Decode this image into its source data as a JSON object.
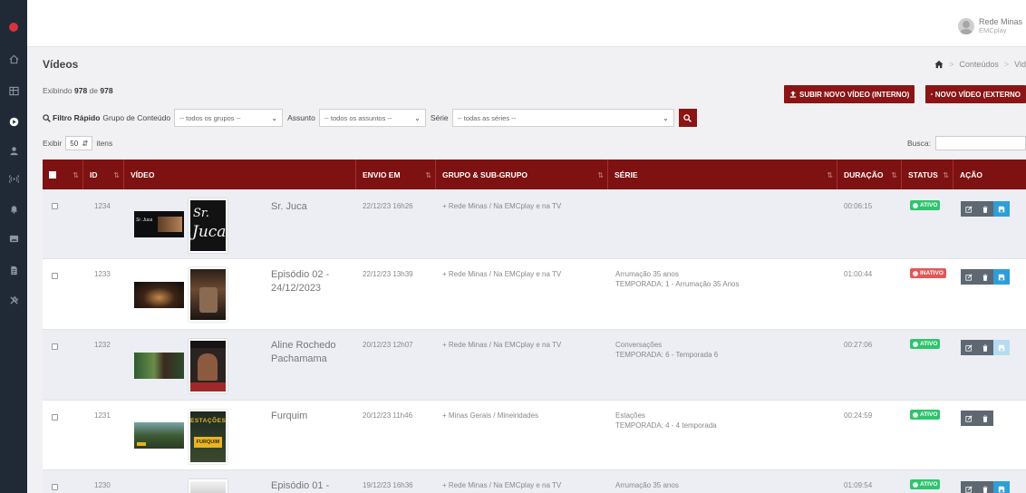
{
  "topbar": {
    "user_name": "Rede Minas",
    "user_sub": "EMCplay"
  },
  "page": {
    "title": "Vídeos",
    "showing_prefix": "Exibindo",
    "showing_count": "978",
    "showing_mid": "de",
    "showing_total": "978"
  },
  "breadcrumb": {
    "items": [
      "Conteúdos",
      "Vid"
    ]
  },
  "buttons": {
    "upload_internal": "SUBIR NOVO VÍDEO (INTERNO)",
    "new_external": "NOVO VÍDEO (EXTERNO"
  },
  "filters": {
    "quick_label": "Filtro Rápido",
    "group_label": "Grupo de Conteúdo",
    "group_value": "-- todos os grupos --",
    "subject_label": "Assunto",
    "subject_value": "-- todos os assuntos --",
    "series_label": "Série",
    "series_value": "-- todas as séries --"
  },
  "pagination": {
    "show_label": "Exibir",
    "per_page": "50",
    "items_label": "itens",
    "search_label": "Busca:"
  },
  "table": {
    "headers": {
      "id": "ID",
      "video": "VÍDEO",
      "sent": "ENVIO EM",
      "group": "GRUPO & SUB-GRUPO",
      "series": "SÉRIE",
      "duration": "DURAÇÃO",
      "status": "STATUS",
      "action": "AÇÃO"
    },
    "rows": [
      {
        "id": "1234",
        "title": "Sr. Juca",
        "sent": "22/12/23 16h26",
        "group": "+ Rede Minas / Na EMCplay e na TV",
        "series": "",
        "season": "",
        "duration": "00:06:15",
        "status": "ATIVO"
      },
      {
        "id": "1233",
        "title": "Episódio 02 -\n24/12/2023",
        "sent": "22/12/23 13h39",
        "group": "+ Rede Minas / Na EMCplay e na TV",
        "series": "Arrumação 35 anos",
        "season": "TEMPORADA: 1 - Arrumação 35 Anos",
        "duration": "01:00:44",
        "status": "INATIVO"
      },
      {
        "id": "1232",
        "title": "Aline Rochedo\nPachamama",
        "sent": "20/12/23 12h07",
        "group": "+ Rede Minas / Na EMCplay e na TV",
        "series": "Conversações",
        "season": "TEMPORADA: 6 - Temporada 6",
        "duration": "00:27:06",
        "status": "ATIVO"
      },
      {
        "id": "1231",
        "title": "Furquim",
        "sent": "20/12/23 11h46",
        "group": "+ Minas Gerais / Mineiridades",
        "series": "Estações",
        "season": "TEMPORADA: 4 - 4 temporada",
        "duration": "00:24:59",
        "status": "ATIVO"
      },
      {
        "id": "1230",
        "title": "Episódio 01 -",
        "sent": "19/12/23 16h36",
        "group": "+ Rede Minas / Na EMCplay e na TV",
        "series": "Arrumação 35 anos",
        "season": "",
        "duration": "01:09:54",
        "status": "ATIVO"
      }
    ]
  },
  "thumb_text": {
    "juca_small": "Sr. Juca",
    "juca_big_1": "Sr.",
    "juca_big_2": "Juca",
    "estacoes": "ESTAÇÕES",
    "furquim": "FURQUIM"
  },
  "colors": {
    "brand_red": "#7e1111",
    "sidebar": "#1f2a36",
    "active": "#2fc46d",
    "inactive": "#e45757",
    "save": "#2e9ed8"
  }
}
